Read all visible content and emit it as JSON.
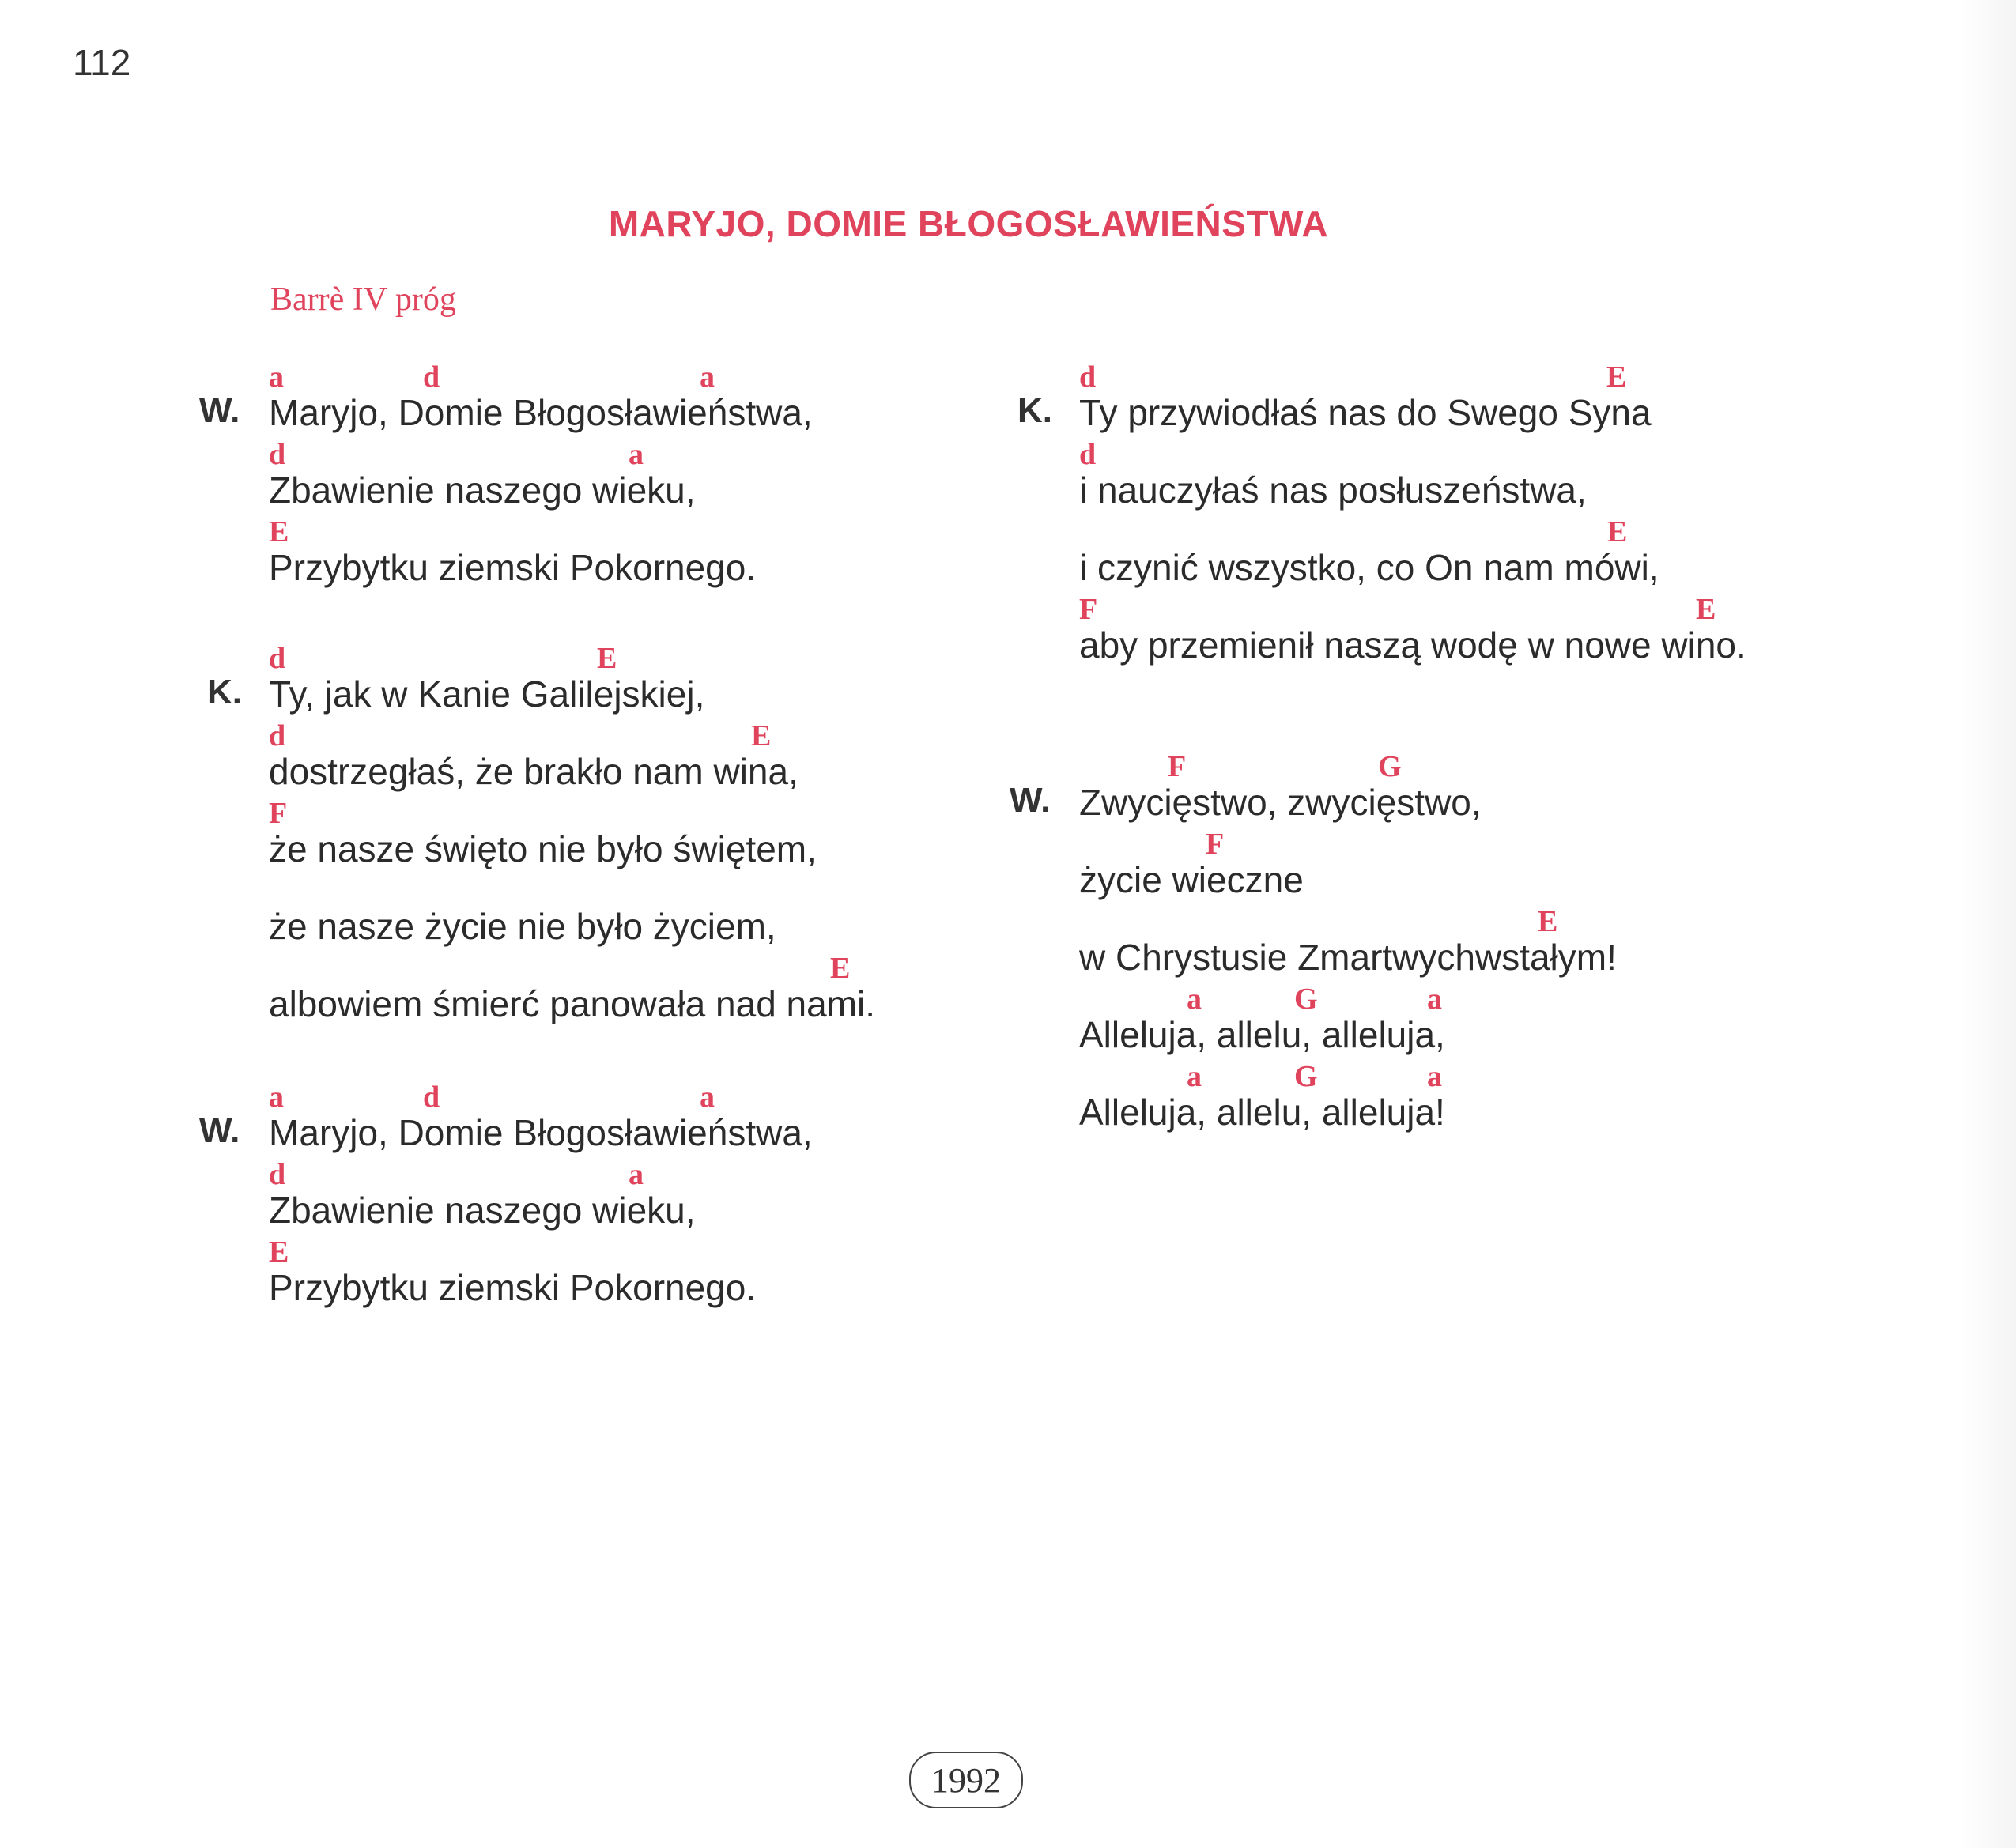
{
  "page": {
    "number": "112",
    "stamp": "1992"
  },
  "song": {
    "title": "MARYJO, DOMIE BŁOGOSŁAWIEŃSTWA",
    "capo": "Barrè IV próg"
  },
  "verses": [
    {
      "label": "W.",
      "lines": [
        {
          "text": "Maryjo, Domie Błogosławieństwa,",
          "chords": [
            "a",
            "d",
            "a"
          ]
        },
        {
          "text": "Zbawienie naszego wieku,",
          "chords": [
            "d",
            "a"
          ]
        },
        {
          "text": "Przybytku ziemski Pokornego.",
          "chords": [
            "E"
          ]
        }
      ]
    },
    {
      "label": "K.",
      "lines": [
        {
          "text": "Ty, jak w Kanie Galilejskiej,",
          "chords": [
            "d",
            "E"
          ]
        },
        {
          "text": "dostrzegłaś, że brakło nam wina,",
          "chords": [
            "d",
            "E"
          ]
        },
        {
          "text": "że nasze święto nie było świętem,",
          "chords": [
            "F"
          ]
        },
        {
          "text": "że nasze życie nie było życiem,",
          "chords": []
        },
        {
          "text": "albowiem śmierć panowała nad nami.",
          "chords": [
            "E"
          ]
        }
      ]
    },
    {
      "label": "W.",
      "lines": [
        {
          "text": "Maryjo, Domie Błogosławieństwa,",
          "chords": [
            "a",
            "d",
            "a"
          ]
        },
        {
          "text": "Zbawienie naszego wieku,",
          "chords": [
            "d",
            "a"
          ]
        },
        {
          "text": "Przybytku ziemski Pokornego.",
          "chords": [
            "E"
          ]
        }
      ]
    },
    {
      "label": "K.",
      "lines": [
        {
          "text": "Ty przywiodłaś nas do Swego Syna",
          "chords": [
            "d",
            "E"
          ]
        },
        {
          "text": "i nauczyłaś nas posłuszeństwa,",
          "chords": [
            "d"
          ]
        },
        {
          "text": "i czynić wszystko, co On nam mówi,",
          "chords": [
            "E"
          ]
        },
        {
          "text": "aby przemienił naszą wodę w nowe wino.",
          "chords": [
            "F",
            "E"
          ]
        }
      ]
    },
    {
      "label": "W.",
      "lines": [
        {
          "text": "Zwycięstwo, zwycięstwo,",
          "chords": [
            "F",
            "G"
          ]
        },
        {
          "text": "życie wieczne",
          "chords": [
            "F"
          ]
        },
        {
          "text": "w Chrystusie Zmartwychwstałym!",
          "chords": [
            "E"
          ]
        },
        {
          "text": "Alleluja, allelu, alleluja,",
          "chords": [
            "a",
            "G",
            "a"
          ]
        },
        {
          "text": "Alleluja, allelu, alleluja!",
          "chords": [
            "a",
            "G",
            "a"
          ]
        }
      ]
    }
  ]
}
